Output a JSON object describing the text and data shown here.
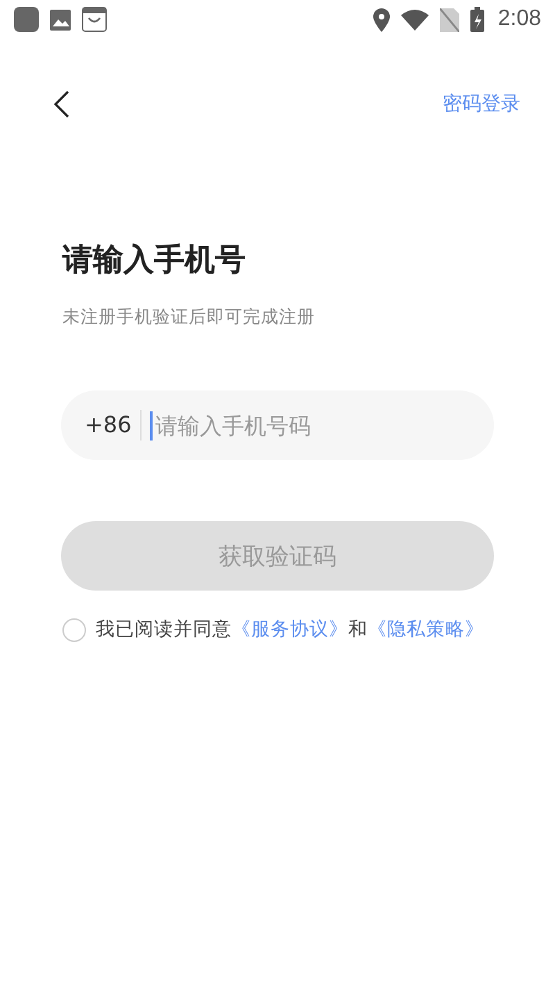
{
  "status_bar": {
    "time": "2:08"
  },
  "nav": {
    "action": "密码登录"
  },
  "title": "请输入手机号",
  "subtitle": "未注册手机验证后即可完成注册",
  "phone_field": {
    "country_code": "+86",
    "placeholder": "请输入手机号码"
  },
  "submit_button": {
    "label": "获取验证码",
    "disabled": true
  },
  "agreement": {
    "checked": false,
    "text": "我已阅读并同意",
    "terms_link": "《服务协议》",
    "joiner": "和",
    "privacy_link": "《隐私策略》"
  }
}
